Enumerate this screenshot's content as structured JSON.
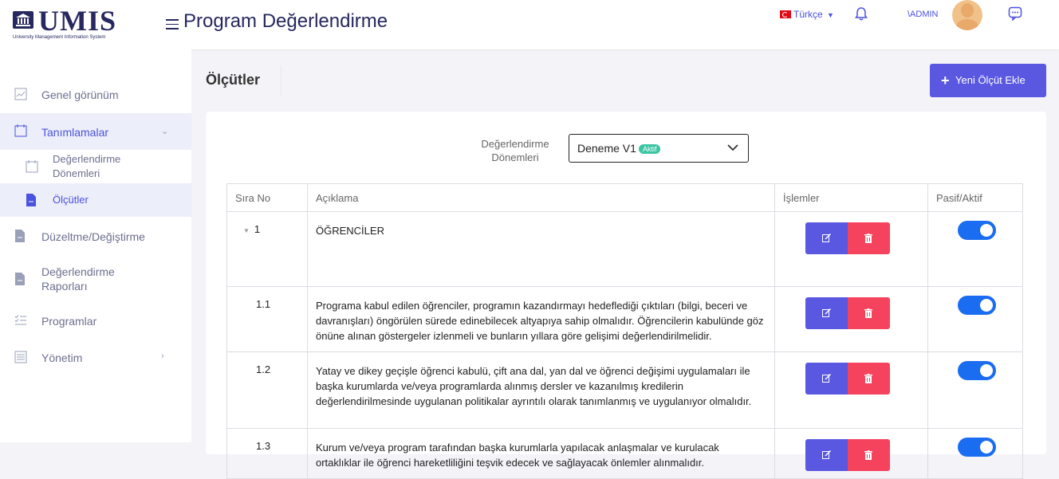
{
  "header": {
    "logo_text": "UMIS",
    "logo_subtitle": "University Management Information System",
    "page_title": "Program Değerlendirme",
    "language": "Türkçe",
    "user": "\\ADMIN"
  },
  "sidebar": {
    "items": [
      {
        "label": "Genel görünüm"
      },
      {
        "label": "Tanımlamalar"
      },
      {
        "label": "Değerlendirme Dönemleri"
      },
      {
        "label": "Ölçütler"
      },
      {
        "label": "Düzeltme/Değiştirme"
      },
      {
        "label": "Değerlendirme Raporları"
      },
      {
        "label": "Programlar"
      },
      {
        "label": "Yönetim"
      }
    ]
  },
  "content": {
    "title": "Ölçütler",
    "add_button": "Yeni Ölçüt Ekle",
    "filter_label": "Değerlendirme Dönemleri",
    "selected_period": "Deneme V1",
    "selected_badge": "Aktif"
  },
  "table": {
    "headers": [
      "Sıra No",
      "Açıklama",
      "İşlemler",
      "Pasif/Aktif"
    ],
    "rows": [
      {
        "no": "1",
        "desc": "ÖĞRENCİLER",
        "active": true
      },
      {
        "no": "1.1",
        "desc": "Programa kabul edilen öğrenciler, programın kazandırmayı hedeflediği çıktıları (bilgi, beceri ve davranışları) öngörülen sürede edinebilecek altyapıya sahip olmalıdır. Öğrencilerin kabulünde göz önüne alınan göstergeler izlenmeli ve bunların yıllara göre gelişimi değerlendirilmelidir.",
        "active": true
      },
      {
        "no": "1.2",
        "desc": "Yatay ve dikey geçişle öğrenci kabulü, çift ana dal, yan dal ve öğrenci değişimi uygulamaları ile başka kurumlarda ve/veya programlarda alınmış dersler ve kazanılmış kredilerin değerlendirilmesinde uygulanan politikalar ayrıntılı olarak tanımlanmış ve uygulanıyor olmalıdır.",
        "active": true
      },
      {
        "no": "1.3",
        "desc": "Kurum ve/veya program tarafından başka kurumlarla yapılacak anlaşmalar ve kurulacak ortaklıklar ile öğrenci hareketliliğini teşvik edecek ve sağlayacak önlemler alınmalıdır.",
        "active": true
      }
    ]
  },
  "colors": {
    "accent": "#5a58e0",
    "danger": "#f5425d",
    "toggle": "#1a6cf0",
    "brand": "#26285e"
  }
}
